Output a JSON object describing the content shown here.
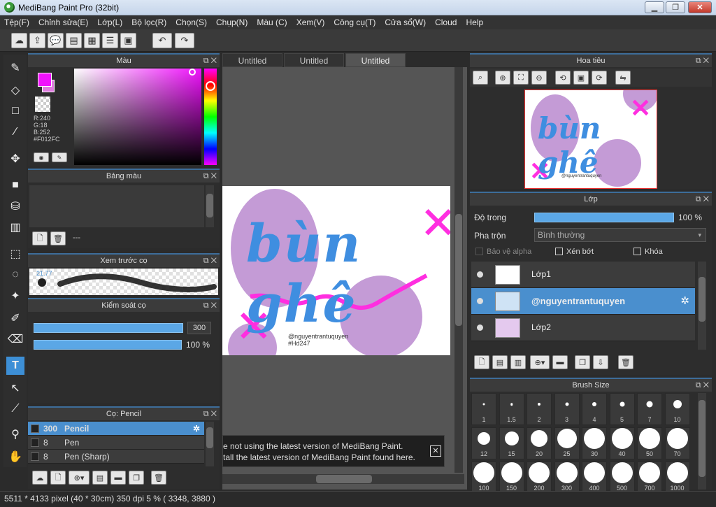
{
  "window": {
    "title": "MediBang Paint Pro (32bit)"
  },
  "menu": [
    "Tệp(F)",
    "Chỉnh sửa(E)",
    "Lớp(L)",
    "Bộ lọc(R)",
    "Chọn(S)",
    "Chụp(N)",
    "Màu (C)",
    "Xem(V)",
    "Công cụ(T)",
    "Cửa sổ(W)",
    "Cloud",
    "Help"
  ],
  "color_panel": {
    "title": "Màu",
    "r": "R:240",
    "g": "G:18",
    "b": "B:252",
    "hex": "#F012FC",
    "fg": "#F012FC",
    "bg": "#E07CE0"
  },
  "palette_panel": {
    "title": "Bảng màu",
    "name": "---"
  },
  "brush_preview": {
    "title": "Xem trước cọ",
    "value": "21.77"
  },
  "brush_control": {
    "title": "Kiểm soát cọ",
    "size": "300",
    "opacity": "100 %",
    "size_fill": 1.0,
    "opacity_fill": 1.0
  },
  "brush_list": {
    "title": "Cọ: Pencil",
    "items": [
      {
        "size": "300",
        "name": "Pencil",
        "selected": true
      },
      {
        "size": "8",
        "name": "Pen",
        "selected": false
      },
      {
        "size": "8",
        "name": "Pen (Sharp)",
        "selected": false
      }
    ]
  },
  "canvas_tabs": [
    "Untitled",
    "Untitled",
    "Untitled"
  ],
  "canvas": {
    "main_text": "bùn ghê",
    "credit": "@nguyentrantuquyen",
    "tag": "#Hd247"
  },
  "notice": {
    "line1": "e not using the latest version of MediBang Paint.",
    "line2": "tall the latest version of MediBang Paint found here."
  },
  "navigator": {
    "title": "Hoa tiêu"
  },
  "layer_panel": {
    "title": "Lớp",
    "opacity_label": "Độ trong",
    "opacity_value": "100 %",
    "opacity_fill": 1.0,
    "blend_label": "Pha trộn",
    "blend_value": "Bình thường",
    "protect_alpha": "Bảo vệ alpha",
    "clipping": "Xén bớt",
    "lock": "Khóa",
    "layers": [
      {
        "name": "Lớp1",
        "selected": false
      },
      {
        "name": "@nguyentrantuquyen",
        "selected": true
      },
      {
        "name": "Lớp2",
        "selected": false
      }
    ]
  },
  "brush_size": {
    "title": "Brush Size",
    "sizes": [
      "1",
      "1.5",
      "2",
      "3",
      "4",
      "5",
      "7",
      "10",
      "12",
      "15",
      "20",
      "25",
      "30",
      "40",
      "50",
      "70",
      "100",
      "150",
      "200",
      "300",
      "400",
      "500",
      "700",
      "1000"
    ]
  },
  "status": {
    "text": "5511 * 4133 pixel  (40 * 30cm)  350 dpi  5 %  ( 3348, 3880 )"
  }
}
